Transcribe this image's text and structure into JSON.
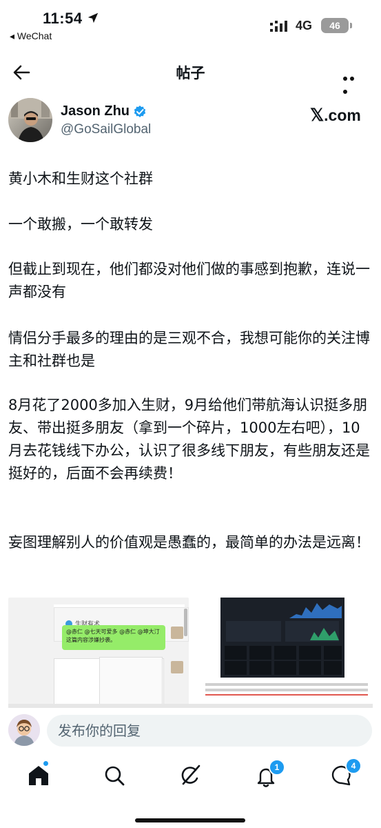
{
  "status_bar": {
    "time": "11:54",
    "back_app": "◂ WeChat",
    "network": "4G",
    "battery": "46"
  },
  "nav": {
    "title": "帖子"
  },
  "author": {
    "name": "Jason Zhu",
    "handle": "@GoSailGlobal",
    "source": ".com"
  },
  "post": {
    "paragraphs": [
      "黄小木和生财这个社群",
      "一个敢搬，一个敢转发",
      "但截止到现在，他们都没对他们做的事感到抱歉，连说一声都没有",
      "情侣分手最多的理由的是三观不合，我想可能你的关注博主和社群也是",
      "8月花了2000多加入生财，9月给他们带航海认识挺多朋友、带出挺多朋友（拿到一个碎片，1000左右吧），10月去花钱线下办公，认识了很多线下朋友，有些朋友还是挺好的，后面不会再续费！",
      "妄图理解别人的价值观是愚蠢的，最简单的办法是远离！"
    ]
  },
  "attachments": {
    "left_chat_text": "@赤仁 @七天可爱多 @赤仁 @坤大汀 这篇内容涉嫌抄袭。",
    "left_header_text": "生财有术"
  },
  "reply": {
    "placeholder": "发布你的回复"
  },
  "tabbar": {
    "notifications_count": "1",
    "messages_count": "4"
  },
  "colors": {
    "accent": "#1d9bf0",
    "text": "#0f1419",
    "muted": "#536471"
  }
}
